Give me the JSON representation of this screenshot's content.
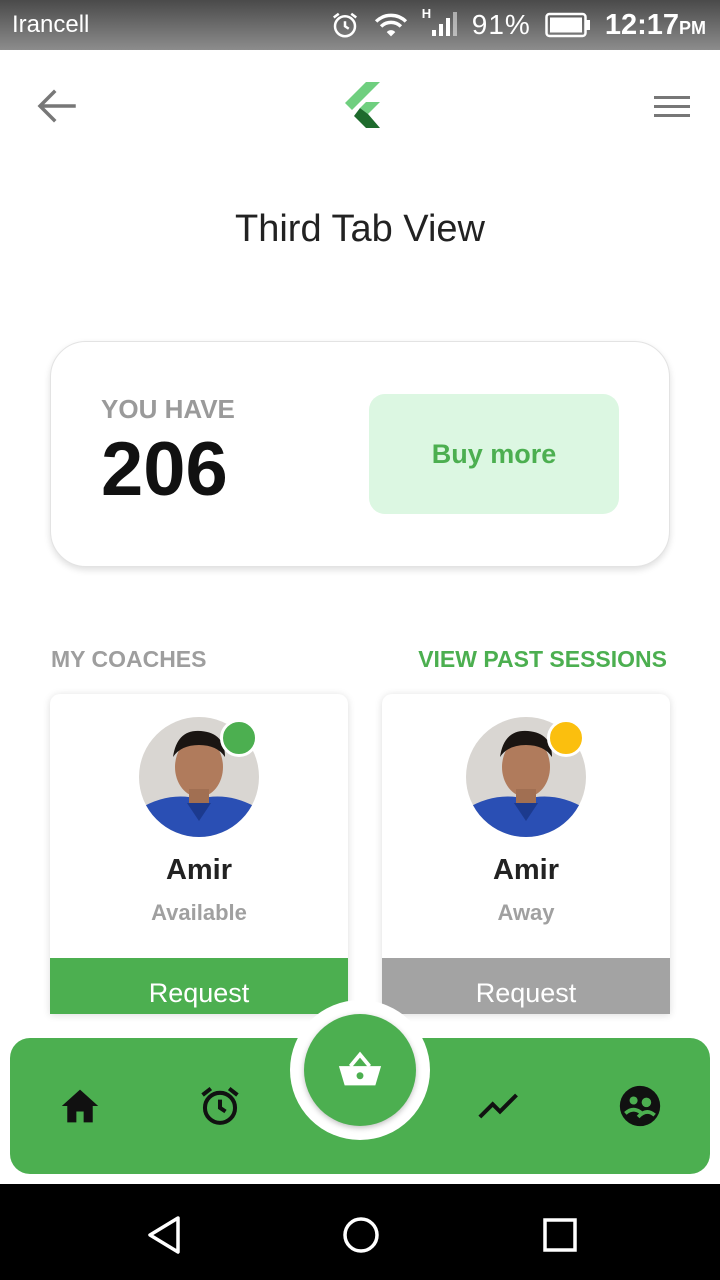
{
  "status_bar": {
    "carrier": "Irancell",
    "network_type": "H",
    "battery": "91%",
    "time": "12:17",
    "ampm": "PM"
  },
  "app_bar": {
    "back_icon": "arrow-back-icon",
    "logo_icon": "flutter-logo-icon",
    "menu_icon": "hamburger-menu-icon"
  },
  "page_title": "Third Tab View",
  "balance_card": {
    "label": "YOU HAVE",
    "count": "206",
    "buy_button": "Buy more"
  },
  "coaches_section": {
    "title": "MY COACHES",
    "link": "VIEW PAST SESSIONS",
    "coaches": [
      {
        "name": "Amir",
        "status": "Available",
        "status_color": "#4caf50",
        "button": "Request"
      },
      {
        "name": "Amir",
        "status": "Away",
        "status_color": "#fbbf0e",
        "button": "Request"
      }
    ]
  },
  "bottom_nav": {
    "items": [
      "home-icon",
      "alarm-icon",
      "basket-icon",
      "trending-icon",
      "community-icon"
    ],
    "accent": "#4caf50"
  },
  "system_nav": [
    "back-triangle-icon",
    "home-circle-icon",
    "recents-square-icon"
  ]
}
